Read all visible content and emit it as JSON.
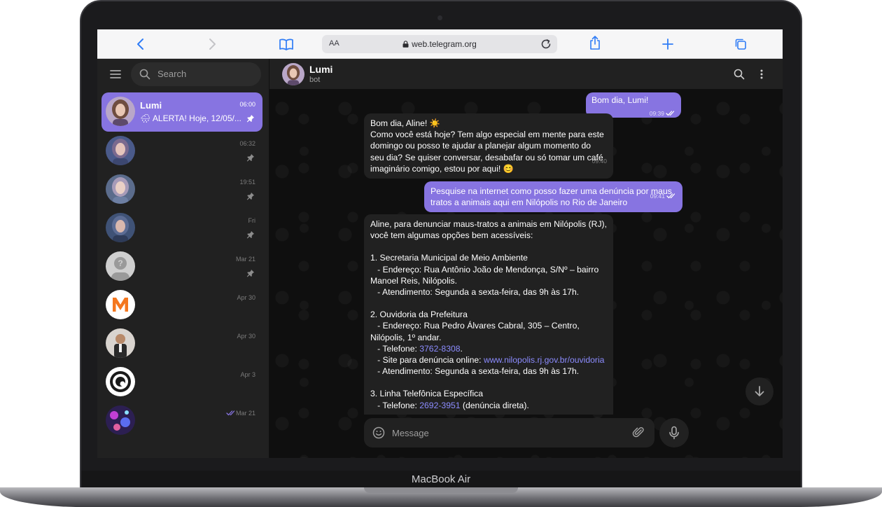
{
  "device": {
    "brand": "MacBook Air"
  },
  "browser": {
    "url": "web.telegram.org",
    "aa_label": "AA",
    "icons": [
      "back-icon",
      "forward-icon",
      "bookmarks-icon",
      "lock-icon",
      "reload-icon",
      "share-icon",
      "new-tab-icon",
      "tabs-icon"
    ]
  },
  "sidebar": {
    "search_placeholder": "Search",
    "chats": [
      {
        "name": "Lumi",
        "time": "06:00",
        "preview": "🌧 ALERTA! Hoje, 12/05/...",
        "pinned": true,
        "active": true
      },
      {
        "name": "",
        "time": "06:32",
        "preview": "",
        "pinned": true
      },
      {
        "name": "",
        "time": "19:51",
        "preview": "",
        "pinned": true
      },
      {
        "name": "",
        "time": "Fri",
        "preview": "",
        "pinned": true
      },
      {
        "name": "",
        "time": "Mar 21",
        "preview": "",
        "pinned": true
      },
      {
        "name": "",
        "time": "Apr 30",
        "preview": ""
      },
      {
        "name": "",
        "time": "Apr 30",
        "preview": ""
      },
      {
        "name": "",
        "time": "Apr 3",
        "preview": ""
      },
      {
        "name": "",
        "time": "Mar 21",
        "preview": "",
        "read": true
      }
    ]
  },
  "chat": {
    "title": "Lumi",
    "subtitle": "bot",
    "composer_placeholder": "Message",
    "messages": [
      {
        "dir": "out",
        "text": "Bom dia, Lumi!",
        "time": "09:39"
      },
      {
        "dir": "in",
        "text": "Bom dia, Aline! ☀️\nComo você está hoje? Tem algo especial em mente para este domingo ou posso te ajudar a planejar algum momento do seu dia? Se quiser conversar, desabafar ou só tomar um café imaginário comigo, estou por aqui! 😊",
        "time": "09:40"
      },
      {
        "dir": "out",
        "text": "Pesquise na internet como posso fazer uma denúncia por maus tratos a animais aqui em Nilópolis no Rio de Janeiro",
        "time": "09:41"
      },
      {
        "dir": "in",
        "intro": "Aline, para denunciar maus-tratos a animais em Nilópolis (RJ), você tem algumas opções bem acessíveis:",
        "s1_title": "1. Secretaria Municipal de Meio Ambiente",
        "s1_address": "   - Endereço: Rua Antônio João de Mendonça, S/Nº – bairro Manoel Reis, Nilópolis.",
        "s1_hours": "   - Atendimento: Segunda a sexta-feira, das 9h às 17h.",
        "s2_title": "2. Ouvidoria da Prefeitura",
        "s2_address": "   - Endereço: Rua Pedro Álvares Cabral, 305 – Centro, Nilópolis, 1º andar.",
        "s2_phone_label": "   - Telefone: ",
        "s2_phone": "3762-8308",
        "s2_phone_end": ".",
        "s2_site_label": "   - Site para denúncia online: ",
        "s2_site": "www.nilopolis.rj.gov.br/ouvidoria",
        "s2_hours": "   - Atendimento: Segunda a sexta-feira, das 9h às 17h.",
        "s3_title": "3. Linha Telefônica Específica",
        "s3_phone_label": "   - Telefone: ",
        "s3_phone": "2692-3951",
        "s3_phone_end": " (denúncia direta)."
      }
    ]
  },
  "colors": {
    "accent": "#8774e1",
    "sidebar_bg": "#212121",
    "chat_bg": "#0f0f0f",
    "link": "#8c8cff",
    "browser_blue": "#2f7cf6"
  }
}
